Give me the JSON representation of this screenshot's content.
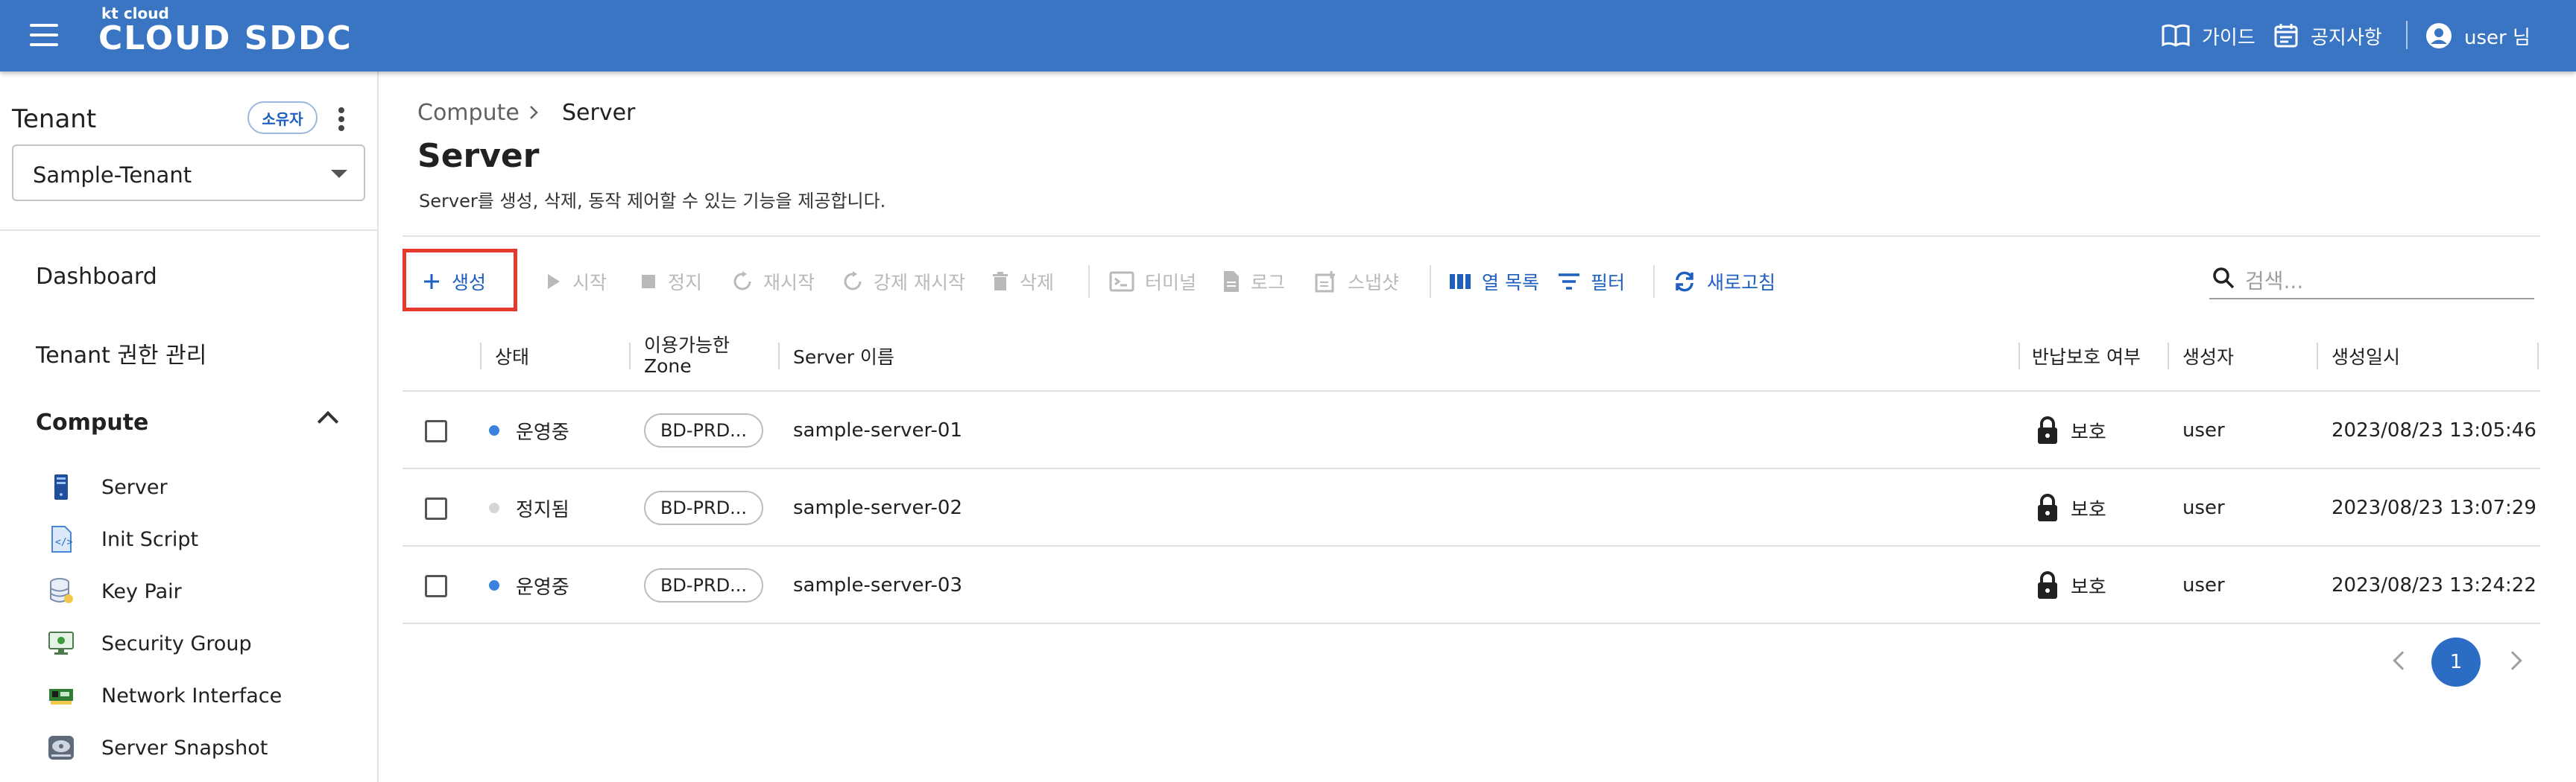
{
  "header": {
    "logo_small": "kt cloud",
    "logo_main": "CLOUD SDDC",
    "guide_label": "가이드",
    "notice_label": "공지사항",
    "user_label": "user 님"
  },
  "sidebar": {
    "tenant_label": "Tenant",
    "owner_badge": "소유자",
    "tenant_selected": "Sample-Tenant",
    "nav": {
      "dashboard": "Dashboard",
      "tenant_auth": "Tenant 권한 관리",
      "compute": "Compute"
    },
    "compute_items": [
      {
        "label": "Server",
        "icon": "server-icon"
      },
      {
        "label": "Init Script",
        "icon": "script-icon"
      },
      {
        "label": "Key Pair",
        "icon": "database-icon"
      },
      {
        "label": "Security Group",
        "icon": "monitor-icon"
      },
      {
        "label": "Network Interface",
        "icon": "network-card-icon"
      },
      {
        "label": "Server Snapshot",
        "icon": "disk-icon"
      }
    ]
  },
  "main": {
    "breadcrumb": [
      "Compute",
      "Server"
    ],
    "title": "Server",
    "description": "Server를 생성, 삭제, 동작 제어할 수 있는 기능을 제공합니다.",
    "toolbar": {
      "create": "생성",
      "start": "시작",
      "stop": "정지",
      "restart": "재시작",
      "force_restart": "강제 재시작",
      "delete": "삭제",
      "terminal": "터미널",
      "log": "로그",
      "snapshot": "스냅샷",
      "columns": "열 목록",
      "filter": "필터",
      "refresh": "새로고침",
      "search_placeholder": "검색..."
    },
    "table": {
      "columns": {
        "status": "상태",
        "zone_line1": "이용가능한",
        "zone_line2": "Zone",
        "name": "Server 이름",
        "protect": "반납보호 여부",
        "creator": "생성자",
        "created": "생성일시"
      },
      "rows": [
        {
          "status": "운영중",
          "zone": "BD-PRD...",
          "name": "sample-server-01",
          "protect": "보호",
          "creator": "user",
          "created": "2023/08/23 13:05:46"
        },
        {
          "status": "정지됨",
          "zone": "BD-PRD...",
          "name": "sample-server-02",
          "protect": "보호",
          "creator": "user",
          "created": "2023/08/23 13:07:29"
        },
        {
          "status": "운영중",
          "zone": "BD-PRD...",
          "name": "sample-server-03",
          "protect": "보호",
          "creator": "user",
          "created": "2023/08/23 13:24:22"
        }
      ]
    },
    "pagination": {
      "current": "1"
    }
  },
  "colors": {
    "header_bg": "#3a75c4",
    "accent": "#1f5fbf",
    "running": "#3b82e0",
    "stopped": "#d6d6d6",
    "highlight_box": "#e53a2f"
  }
}
